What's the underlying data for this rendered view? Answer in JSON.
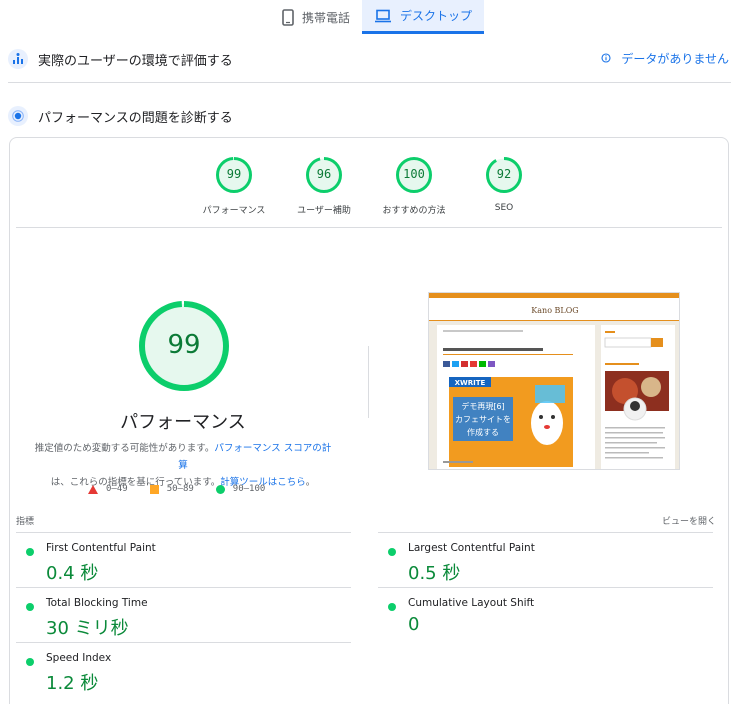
{
  "tabs": {
    "mobile_label": "携帯電話",
    "desktop_label": "デスクトップ"
  },
  "field_section": {
    "title": "実際のユーザーの環境で評価する",
    "no_data_label": "データがありません"
  },
  "diagnose_section": {
    "title": "パフォーマンスの問題を診断する"
  },
  "scores": [
    {
      "value": "99",
      "label": "パフォーマンス",
      "fraction": 0.99
    },
    {
      "value": "96",
      "label": "ユーザー補助",
      "fraction": 0.96
    },
    {
      "value": "100",
      "label": "おすすめの方法",
      "fraction": 1.0
    },
    {
      "value": "92",
      "label": "SEO",
      "fraction": 0.92
    }
  ],
  "main_score": {
    "value": "99",
    "fraction": 0.99,
    "title": "パフォーマンス",
    "desc_1": "推定値のため変動する可能性があります。",
    "desc_link_1": "パフォーマンス スコアの計算",
    "desc_2": "は、これらの指標を基に行っています。",
    "desc_link_2": "計算ツールはこちら",
    "desc_3": "。"
  },
  "legend": {
    "fail": "0–49",
    "average": "50–89",
    "pass": "90–100"
  },
  "metrics_header": {
    "title": "指標",
    "expand_label": "ビューを開く"
  },
  "metrics": [
    {
      "label": "First Contentful Paint",
      "value": "0.4 秒"
    },
    {
      "label": "Largest Contentful Paint",
      "value": "0.5 秒"
    },
    {
      "label": "Total Blocking Time",
      "value": "30 ミリ秒"
    },
    {
      "label": "Cumulative Layout Shift",
      "value": "0"
    },
    {
      "label": "Speed Index",
      "value": "1.2 秒"
    }
  ],
  "thumbnail": {
    "site_title": "Kano BLOG",
    "banner_line1": "デモ再現[6]",
    "banner_line2": "カフェサイトを",
    "banner_line3": "作成する",
    "xwrite": "XWRITE"
  },
  "colors": {
    "pass_green": "#0cce6b",
    "score_text": "#0b7a36",
    "accent_blue": "#1a73e8",
    "fail_red": "#e53935",
    "average_orange": "#ffa726"
  }
}
